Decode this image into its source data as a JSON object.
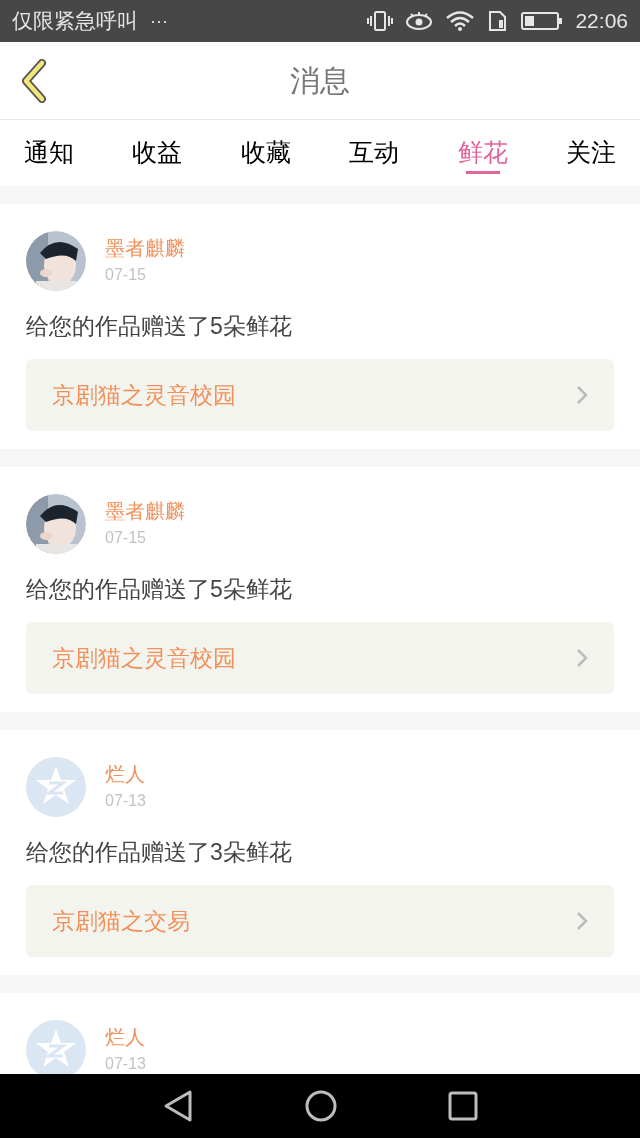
{
  "status_bar": {
    "carrier": "仅限紧急呼叫",
    "more": "···",
    "time": "22:06"
  },
  "header": {
    "title": "消息"
  },
  "tabs": [
    {
      "label": "通知",
      "selected": false
    },
    {
      "label": "收益",
      "selected": false
    },
    {
      "label": "收藏",
      "selected": false
    },
    {
      "label": "互动",
      "selected": false
    },
    {
      "label": "鲜花",
      "selected": true
    },
    {
      "label": "关注",
      "selected": false
    }
  ],
  "messages": [
    {
      "name": "墨者麒麟",
      "date": "07-15",
      "text": "给您的作品赠送了5朵鲜花",
      "work": "京剧猫之灵音校园"
    },
    {
      "name": "墨者麒麟",
      "date": "07-15",
      "text": "给您的作品赠送了5朵鲜花",
      "work": "京剧猫之灵音校园"
    },
    {
      "avatar": {
        "kind": "default"
      },
      "name": "烂人",
      "date": "07-13",
      "text": "给您的作品赠送了3朵鲜花",
      "work": "京剧猫之交易"
    },
    {
      "avatar": {
        "kind": "default"
      },
      "name": "烂人",
      "date": "07-13"
    }
  ]
}
